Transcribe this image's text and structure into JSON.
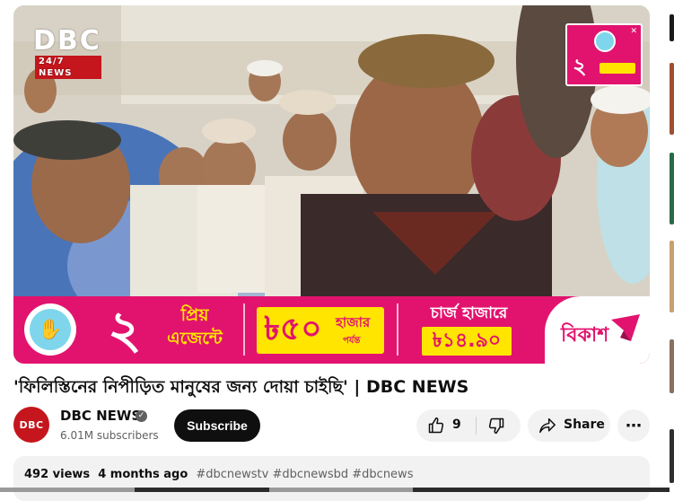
{
  "video": {
    "logo_text": "DBC",
    "logo_sub": "24/7 NEWS",
    "corner_ad_number": "২",
    "banner": {
      "number": "২",
      "line1": "প্রিয়",
      "line2": "এজেন্টে",
      "amount": "৳৫০",
      "amount_suffix": "হাজার",
      "amount_note": "পর্যন্ত",
      "charge_label": "চার্জ হাজারে",
      "charge_rate": "৳১৪.৯০",
      "brand": "বিকাশ"
    }
  },
  "title": "'ফিলিস্তিনের নিপীড়িত মানুষের জন্য দোয়া চাইছি' | DBC NEWS",
  "channel": {
    "avatar_text": "DBC",
    "name": "DBC NEWS",
    "subscribers": "6.01M subscribers",
    "subscribe_label": "Subscribe"
  },
  "actions": {
    "like_count": "9",
    "share_label": "Share",
    "more_label": "⋯"
  },
  "description": {
    "views": "492 views",
    "age": "4 months ago",
    "tags": "#dbcnewstv #dbcnewsbd #dbcnews"
  },
  "colors": {
    "bkash_pink": "#e2136e",
    "bkash_yellow": "#ffe500",
    "dbc_red": "#c4161c"
  }
}
